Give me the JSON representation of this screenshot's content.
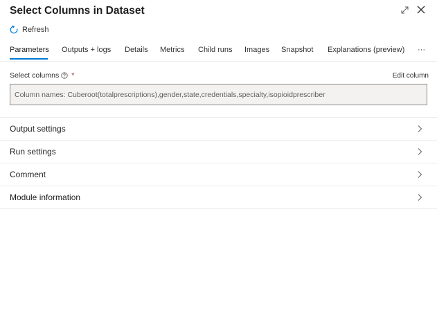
{
  "panel": {
    "title": "Select Columns in Dataset",
    "refresh_label": "Refresh"
  },
  "tabs": [
    {
      "label": "Parameters",
      "active": true
    },
    {
      "label": "Outputs + logs"
    },
    {
      "label": "Details"
    },
    {
      "label": "Metrics"
    },
    {
      "label": "Child runs"
    },
    {
      "label": "Images"
    },
    {
      "label": "Snapshot"
    },
    {
      "label": "Explanations (preview)"
    },
    {
      "label": "···"
    }
  ],
  "parameters": {
    "select_columns_label": "Select columns",
    "required_mark": "*",
    "edit_column_label": "Edit column",
    "column_names_value": "Column names: Cuberoot(totalprescriptions),gender,state,credentials,specialty,isopioidprescriber"
  },
  "sections": [
    {
      "label": "Output settings"
    },
    {
      "label": "Run settings"
    },
    {
      "label": "Comment"
    },
    {
      "label": "Module information"
    }
  ],
  "colors": {
    "accent": "#0078d4",
    "required": "#a4262c",
    "divider": "#edebe9"
  },
  "icons": {
    "expand": "expand-icon",
    "close": "close-icon",
    "refresh": "refresh-icon",
    "info": "info-icon",
    "chevron": "chevron-right-icon"
  }
}
